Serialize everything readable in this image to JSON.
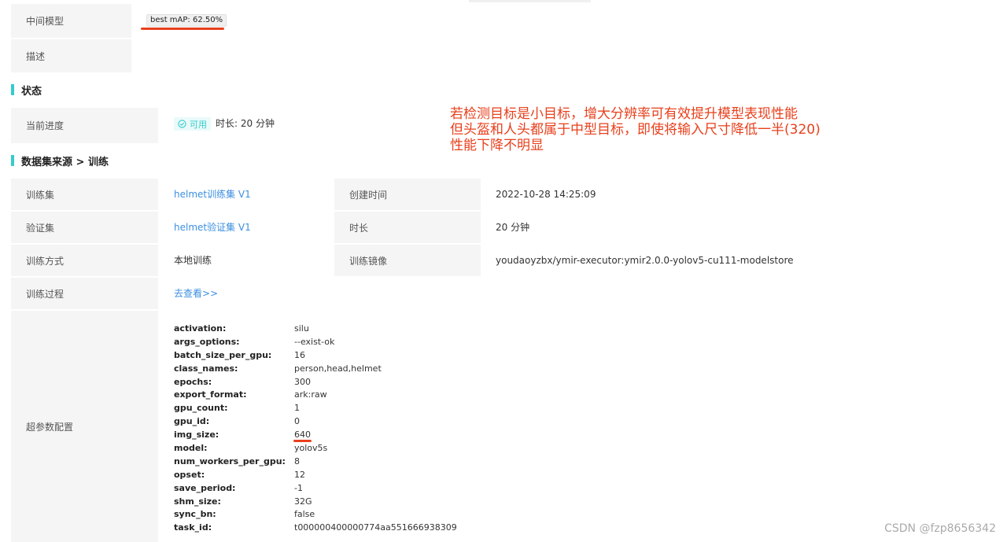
{
  "model": {
    "intermediate_label": "中间模型",
    "best_map": "best mAP: 62.50%",
    "description_label": "描述"
  },
  "status_section": {
    "title": "状态",
    "progress_label": "当前进度",
    "status_tag": "可用",
    "duration": "时长: 20 分钟"
  },
  "dataset_section": {
    "title": "数据集来源 > 训练",
    "rows": [
      {
        "label": "训练集",
        "value": "helmet训练集 V1",
        "label2": "创建时间",
        "value2": "2022-10-28 14:25:09"
      },
      {
        "label": "验证集",
        "value": "helmet验证集 V1",
        "label2": "时长",
        "value2": "20 分钟"
      },
      {
        "label": "训练方式",
        "value": "本地训练",
        "label2": "训练镜像",
        "value2": "youdaoyzbx/ymir-executor:ymir2.0.0-yolov5-cu111-modelstore"
      }
    ],
    "process_label": "训练过程",
    "process_link": "去查看>>",
    "hyper_label": "超参数配置"
  },
  "hyperparams": [
    {
      "key": "activation:",
      "value": "silu"
    },
    {
      "key": "args_options:",
      "value": "--exist-ok"
    },
    {
      "key": "batch_size_per_gpu:",
      "value": "16"
    },
    {
      "key": "class_names:",
      "value": "person,head,helmet"
    },
    {
      "key": "epochs:",
      "value": "300"
    },
    {
      "key": "export_format:",
      "value": "ark:raw"
    },
    {
      "key": "gpu_count:",
      "value": "1"
    },
    {
      "key": "gpu_id:",
      "value": "0"
    },
    {
      "key": "img_size:",
      "value": "640"
    },
    {
      "key": "model:",
      "value": "yolov5s"
    },
    {
      "key": "num_workers_per_gpu:",
      "value": "8"
    },
    {
      "key": "opset:",
      "value": "12"
    },
    {
      "key": "save_period:",
      "value": "-1"
    },
    {
      "key": "shm_size:",
      "value": "32G"
    },
    {
      "key": "sync_bn:",
      "value": "false"
    },
    {
      "key": "task_id:",
      "value": "t000000400000774aa551666938309"
    }
  ],
  "annotation": {
    "line1": "若检测目标是小目标，增大分辨率可有效提升模型表现性能",
    "line2": "但头盔和人头都属于中型目标，即使将输入尺寸降低一半(320)",
    "line3": "性能下降不明显"
  },
  "watermark": "CSDN @fzp8656342",
  "colors": {
    "accent": "#36cbcb",
    "link": "#3b8fe0",
    "annotation": "#e8401c",
    "label_bg": "#f5f5f5"
  },
  "icons": {
    "status": "check-circle-icon"
  }
}
